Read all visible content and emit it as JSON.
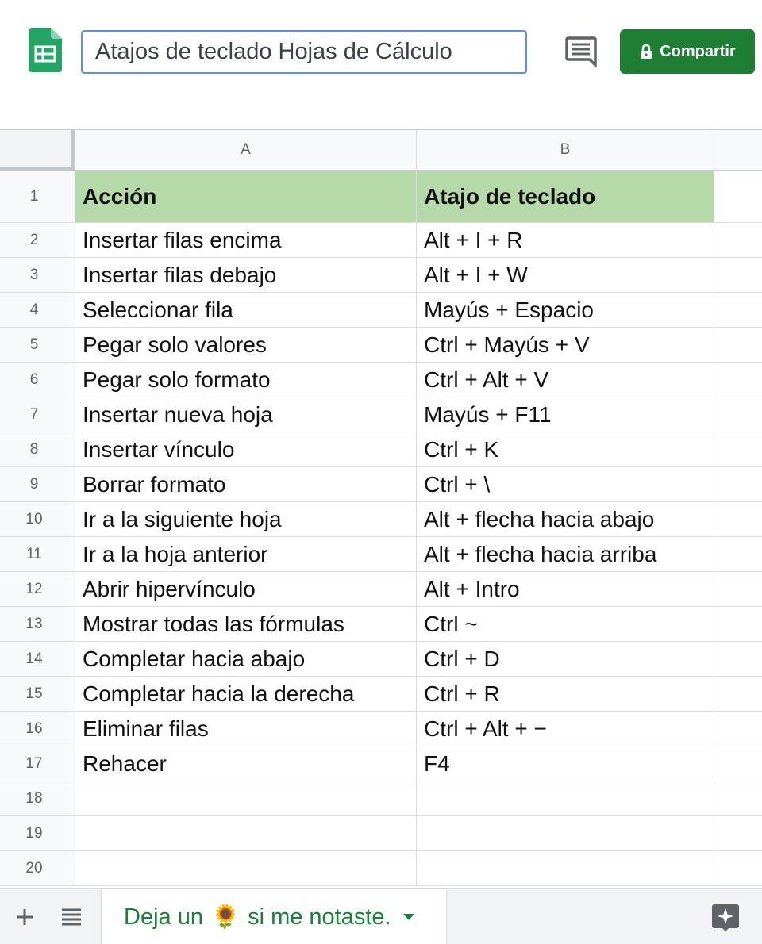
{
  "header": {
    "title": "Atajos de teclado Hojas de Cálculo",
    "share_label": "Compartir",
    "share_color": "#1e7e34",
    "icons": [
      "sheets-logo-icon",
      "comment-icon",
      "lock-icon"
    ]
  },
  "grid": {
    "columns": [
      "A",
      "B"
    ],
    "header_fill": "#b5d9a8",
    "row_numbers": [
      "1",
      "2",
      "3",
      "4",
      "5",
      "6",
      "7",
      "8",
      "9",
      "10",
      "11",
      "12",
      "13",
      "14",
      "15",
      "16",
      "17",
      "18",
      "19",
      "20"
    ],
    "rows": [
      [
        "Acción",
        "Atajo de teclado"
      ],
      [
        "Insertar filas encima",
        "Alt + I + R"
      ],
      [
        "Insertar filas debajo",
        "Alt + I + W"
      ],
      [
        "Seleccionar fila",
        "Mayús + Espacio"
      ],
      [
        "Pegar solo valores",
        "Ctrl + Mayús + V"
      ],
      [
        "Pegar solo formato",
        "Ctrl + Alt + V"
      ],
      [
        "Insertar nueva hoja",
        "Mayús + F11"
      ],
      [
        "Insertar vínculo",
        "Ctrl + K"
      ],
      [
        "Borrar formato",
        "Ctrl + \\"
      ],
      [
        "Ir a la siguiente hoja",
        "Alt + flecha hacia abajo"
      ],
      [
        "Ir a la hoja anterior",
        "Alt + flecha hacia arriba"
      ],
      [
        "Abrir hipervínculo",
        "Alt + Intro"
      ],
      [
        "Mostrar todas las fórmulas",
        "Ctrl ~"
      ],
      [
        "Completar hacia abajo",
        "Ctrl + D"
      ],
      [
        "Completar hacia la derecha",
        "Ctrl + R"
      ],
      [
        "Eliminar filas",
        "Ctrl + Alt + −"
      ],
      [
        "Rehacer",
        "F4"
      ],
      [
        "",
        ""
      ],
      [
        "",
        ""
      ],
      [
        "",
        ""
      ]
    ]
  },
  "bottom": {
    "sheet_tab_before": "Deja un",
    "sheet_tab_emoji": "🌻",
    "sheet_tab_after": "si me notaste.",
    "tab_color": "#188038",
    "icons": [
      "add-sheet-icon",
      "all-sheets-icon",
      "explore-icon"
    ]
  }
}
